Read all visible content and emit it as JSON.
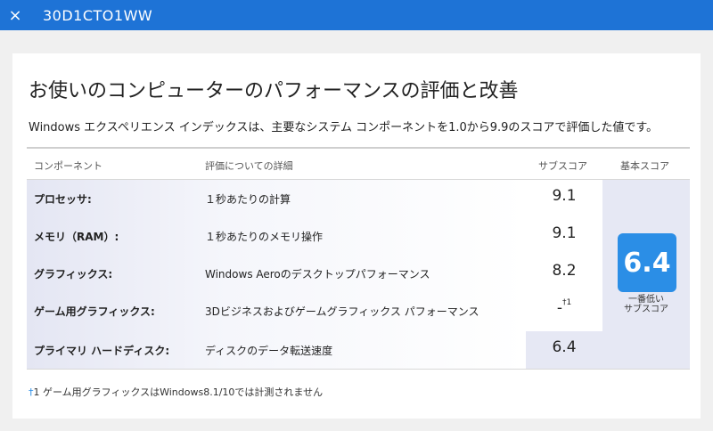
{
  "window": {
    "title": "30D1CTO1WW",
    "close_icon": "×"
  },
  "page": {
    "heading": "お使いのコンピューターのパフォーマンスの評価と改善",
    "description": "Windows エクスペリエンス インデックスは、主要なシステム コンポーネントを1.0から9.9のスコアで評価した値です。"
  },
  "table": {
    "headers": {
      "component": "コンポーネント",
      "details": "評価についての詳細",
      "subscore": "サブスコア",
      "basescore": "基本スコア"
    },
    "rows": [
      {
        "label": "プロセッサ:",
        "detail": "１秒あたりの計算",
        "subscore": "9.1",
        "note": ""
      },
      {
        "label": "メモリ（RAM）:",
        "detail": "１秒あたりのメモリ操作",
        "subscore": "9.1",
        "note": ""
      },
      {
        "label": "グラフィックス:",
        "detail": "Windows Aeroのデスクトップパフォーマンス",
        "subscore": "8.2",
        "note": ""
      },
      {
        "label": "ゲーム用グラフィックス:",
        "detail": "3Dビジネスおよびゲームグラフィックス パフォーマンス",
        "subscore": "-",
        "note": "†1"
      },
      {
        "label": "プライマリ ハードディスク:",
        "detail": "ディスクのデータ転送速度",
        "subscore": "6.4",
        "note": ""
      }
    ],
    "base_score": "6.4",
    "base_score_caption_1": "一番低い",
    "base_score_caption_2": "サブスコア"
  },
  "footnote": {
    "mark": "†",
    "text": "1 ゲーム用グラフィックスはWindows8.1/10では計測されません"
  },
  "colors": {
    "titlebar": "#1e73d6",
    "score_box": "#2b8ee6",
    "shade": "#e6e8f4"
  }
}
